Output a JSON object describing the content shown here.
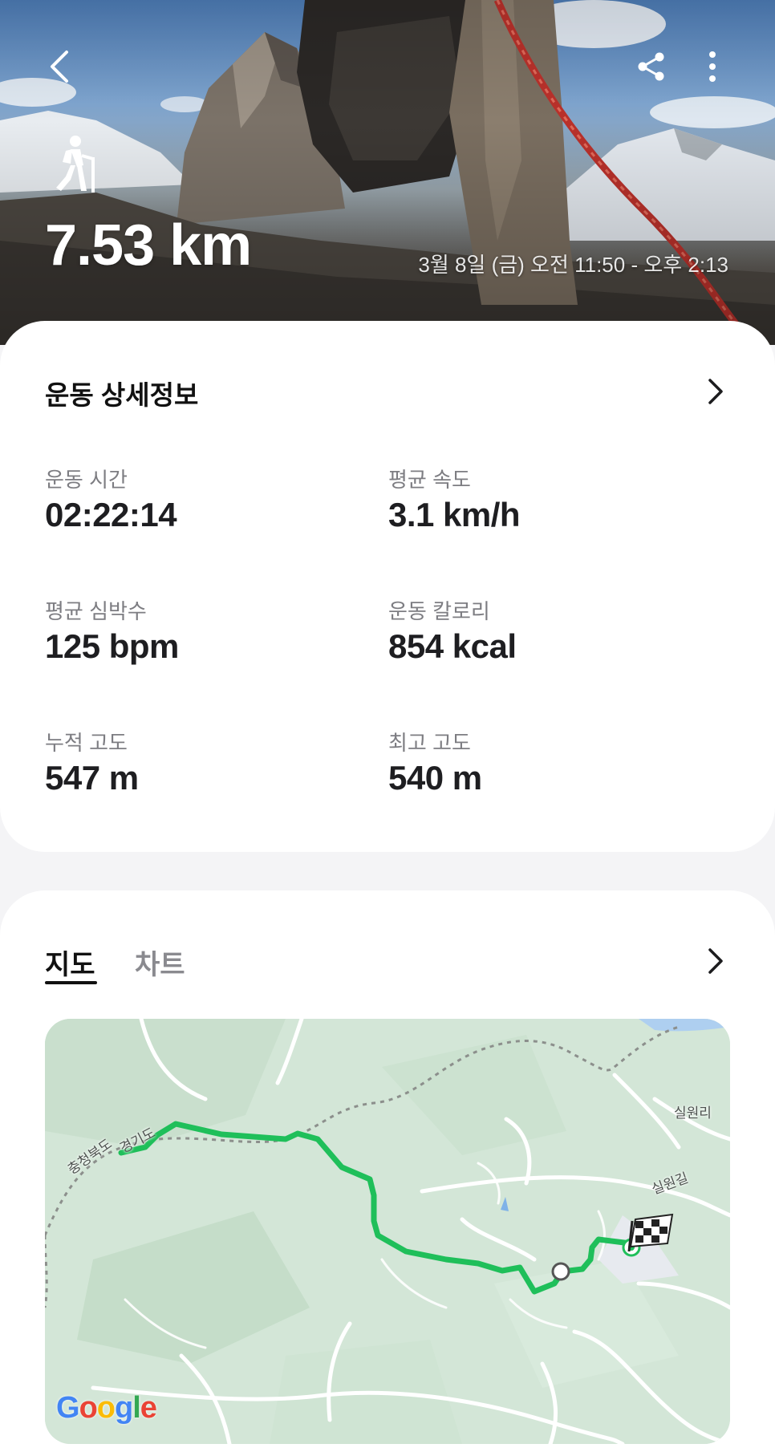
{
  "header": {
    "distance": "7.53 km",
    "date_range": "3월 8일 (금) 오전 11:50 - 오후 2:13",
    "icons": {
      "back": "chevron-left-icon",
      "share": "share-icon",
      "more": "more-vertical-icon",
      "activity": "hiking-icon"
    }
  },
  "details": {
    "title": "운동 상세정보",
    "stats": [
      {
        "label": "운동 시간",
        "value": "02:22:14"
      },
      {
        "label": "평균 속도",
        "value": "3.1 km/h"
      },
      {
        "label": "평균 심박수",
        "value": "125 bpm"
      },
      {
        "label": "운동 칼로리",
        "value": "854 kcal"
      },
      {
        "label": "누적 고도",
        "value": "547 m"
      },
      {
        "label": "최고 고도",
        "value": "540 m"
      }
    ]
  },
  "map_section": {
    "tabs": [
      {
        "label": "지도",
        "active": true
      },
      {
        "label": "차트",
        "active": false
      }
    ],
    "map": {
      "labels": {
        "chungbuk": "충청북도",
        "gyeonggi": "경기도",
        "silwonri": "실원리",
        "silwongil": "실원길"
      },
      "provider": "Google"
    }
  },
  "colors": {
    "route": "#1fbf5a",
    "card_background": "#ffffff",
    "page_background": "#f4f4f6",
    "map_background": "#d6e7da"
  }
}
